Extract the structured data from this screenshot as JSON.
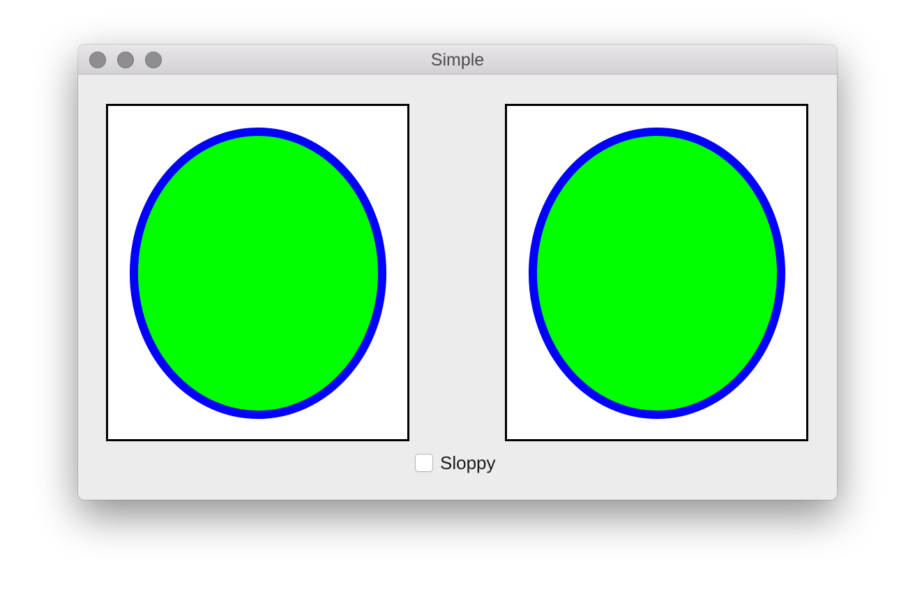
{
  "window": {
    "title": "Simple",
    "controls": {
      "close": "close-button",
      "minimize": "minimize-button",
      "zoom": "zoom-button"
    }
  },
  "canvases": [
    {
      "shape": "ellipse",
      "fill": "#00ff00",
      "stroke": "#0000ff"
    },
    {
      "shape": "ellipse",
      "fill": "#00ff00",
      "stroke": "#0000ff"
    }
  ],
  "options": {
    "sloppy_label": "Sloppy",
    "sloppy_checked": false
  },
  "colors": {
    "ellipse_fill": "#00ff00",
    "ellipse_stroke": "#0000ff",
    "canvas_border": "#000000",
    "window_bg": "#ececec"
  }
}
